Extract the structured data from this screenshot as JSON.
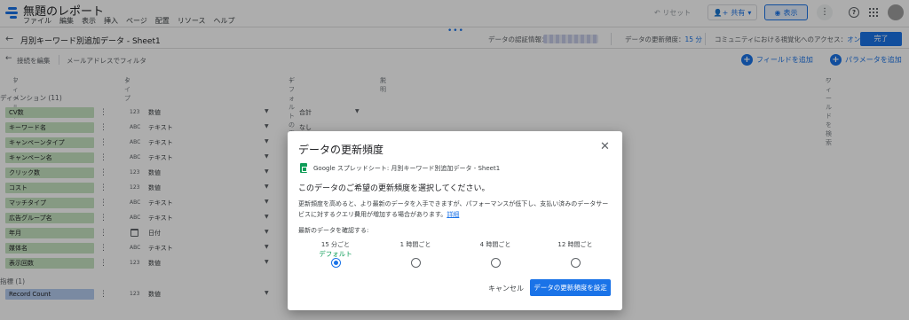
{
  "app": {
    "title": "無題のレポート",
    "menu": [
      "ファイル",
      "編集",
      "表示",
      "挿入",
      "ページ",
      "配置",
      "リソース",
      "ヘルプ"
    ],
    "reset_label": "リセット",
    "share_label": "共有",
    "view_label": "表示"
  },
  "datasource": {
    "name": "月別キーワード別追加データ - Sheet1",
    "credentials_label": "データの認証情報：",
    "freshness_label": "データの更新頻度：",
    "freshness_value": "15 分",
    "community_label": "コミュニティにおける視覚化へのアクセス：",
    "community_value": "オン",
    "done_label": "完了"
  },
  "subbar": {
    "edit_connection": "接続を編集",
    "email_filter": "メールアドレスでフィルタ",
    "add_field": "フィールドを追加",
    "add_parameter": "パラメータを追加"
  },
  "columns": {
    "field": "フィールド",
    "type": "タイプ",
    "default_agg": "デフォルトの集計",
    "description": "説明",
    "search": "フィールドを検索"
  },
  "sections": {
    "dimensions": "ディメンション (11)",
    "metrics": "指標 (1)"
  },
  "fields": [
    {
      "name": "CV数",
      "type_icon": "123",
      "type": "数値",
      "agg": "合計"
    },
    {
      "name": "キーワード名",
      "type_icon": "ABC",
      "type": "テキスト",
      "agg": "なし"
    },
    {
      "name": "キャンペーンタイプ",
      "type_icon": "ABC",
      "type": "テキスト",
      "agg": ""
    },
    {
      "name": "キャンペーン名",
      "type_icon": "ABC",
      "type": "テキスト",
      "agg": ""
    },
    {
      "name": "クリック数",
      "type_icon": "123",
      "type": "数値",
      "agg": ""
    },
    {
      "name": "コスト",
      "type_icon": "123",
      "type": "数値",
      "agg": ""
    },
    {
      "name": "マッチタイプ",
      "type_icon": "ABC",
      "type": "テキスト",
      "agg": ""
    },
    {
      "name": "広告グループ名",
      "type_icon": "ABC",
      "type": "テキスト",
      "agg": ""
    },
    {
      "name": "年月",
      "type_icon": "calendar",
      "type": "日付",
      "agg": ""
    },
    {
      "name": "媒体名",
      "type_icon": "ABC",
      "type": "テキスト",
      "agg": ""
    },
    {
      "name": "表示回数",
      "type_icon": "123",
      "type": "数値",
      "agg": ""
    }
  ],
  "metrics": [
    {
      "name": "Record Count",
      "type_icon": "123",
      "type": "数値",
      "agg": ""
    }
  ],
  "modal": {
    "title": "データの更新頻度",
    "source": "Google スプレッドシート: 月別キーワード別追加データ - Sheet1",
    "heading": "このデータのご希望の更新頻度を選択してください。",
    "desc": "更新頻度を高めると、より最新のデータを入手できますが、パフォーマンスが低下し、支払い済みのデータサービスに対するクエリ費用が増加する場合があります。",
    "desc_link": "詳細",
    "check_label": "最新のデータを確認する:",
    "options": [
      {
        "label": "15 分ごと",
        "sub": "デフォルト",
        "selected": true
      },
      {
        "label": "1 時間ごと",
        "sub": "",
        "selected": false
      },
      {
        "label": "4 時間ごと",
        "sub": "",
        "selected": false
      },
      {
        "label": "12 時間ごと",
        "sub": "",
        "selected": false
      }
    ],
    "cancel_label": "キャンセル",
    "set_label": "データの更新頻度を設定"
  }
}
